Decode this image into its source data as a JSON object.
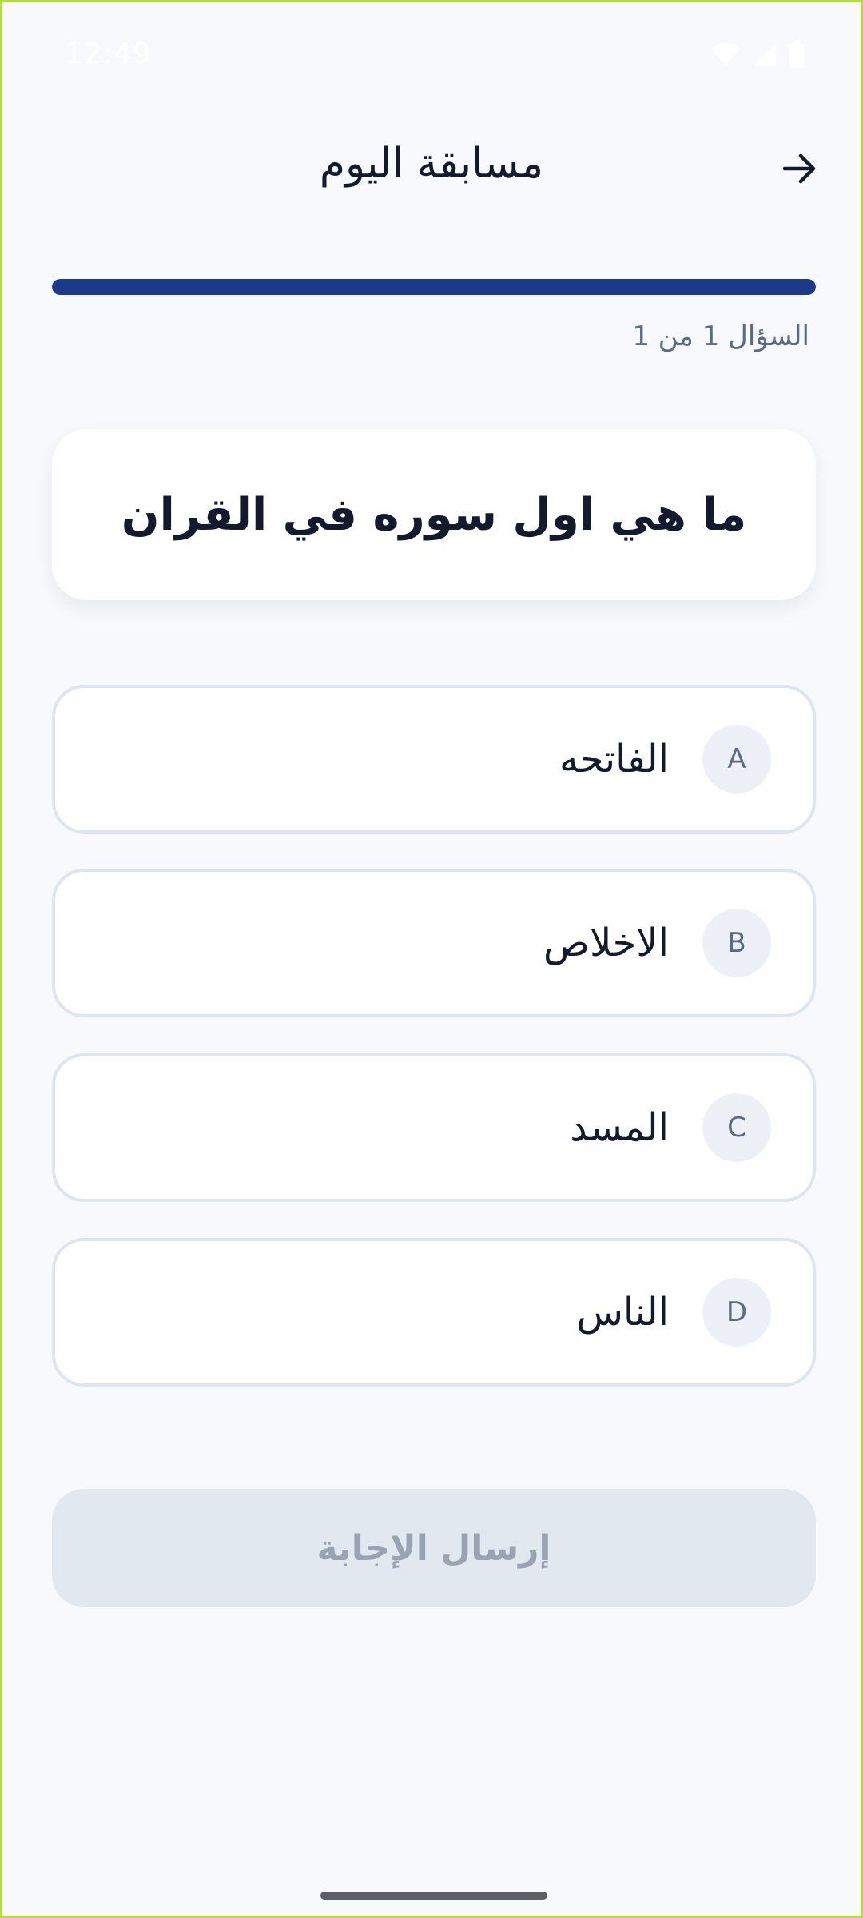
{
  "status_bar": {
    "time": "12:49",
    "icons": [
      "wifi-icon",
      "cell-signal-icon",
      "battery-icon"
    ]
  },
  "header": {
    "title": "مسابقة اليوم",
    "back_icon": "arrow-right-icon"
  },
  "progress": {
    "fraction": 1.0,
    "text": "السؤال 1 من 1"
  },
  "question": {
    "text": "ما هي اول سوره في القران"
  },
  "options": [
    {
      "letter": "A",
      "text": "الفاتحه"
    },
    {
      "letter": "B",
      "text": "الاخلاص"
    },
    {
      "letter": "C",
      "text": "المسد"
    },
    {
      "letter": "D",
      "text": "الناس"
    }
  ],
  "submit": {
    "label": "إرسال الإجابة",
    "enabled": false
  },
  "colors": {
    "background": "#f7f9fc",
    "accent": "#1d3a8a",
    "text_primary": "#131a2e",
    "text_secondary": "#5b6a85",
    "disabled_button": "#e2e8f0",
    "disabled_text": "#9aa3b2"
  }
}
